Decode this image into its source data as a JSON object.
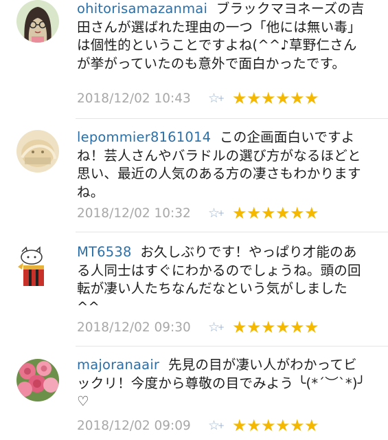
{
  "comments": [
    {
      "user": "ohitorisamazanmai",
      "text": "ブラックマヨネーズの吉田さんが選ばれた理由の一つ「他には無い毒」は個性的ということですよね(^^♪草野仁さんが挙がっていたのも意外で面白かったです。",
      "timestamp": "2018/12/02 10:43",
      "rating": 5,
      "avatar_icon": "woman-with-glasses-avatar-icon"
    },
    {
      "user": "lepommier8161014",
      "text": "この企画面白いですよね！芸人さんやバラドルの選び方がなるほどと思い、最近の人気のある方の凄さもわかりますね。",
      "timestamp": "2018/12/02 10:32",
      "rating": 5,
      "avatar_icon": "beige-character-avatar-icon"
    },
    {
      "user": "MT6538",
      "text": "お久しぶりです！やっぱり才能のある人同士はすぐにわかるのでしょうね。頭の回転が凄い人たちなんだなという気がしました^^",
      "timestamp": "2018/12/02 09:30",
      "rating": 5,
      "avatar_icon": "cat-in-box-avatar-icon"
    },
    {
      "user": "majoranaair",
      "text": "先見の目が凄い人がわかってビックリ！今度から尊敬の目でみよう ╰(*´︶`*)╯ ♡",
      "timestamp": "2018/12/02 09:09",
      "rating": 5,
      "avatar_icon": "pink-roses-avatar-icon"
    }
  ],
  "star_glyph": "★",
  "fav_glyph": "☆",
  "fav_plus": "+"
}
